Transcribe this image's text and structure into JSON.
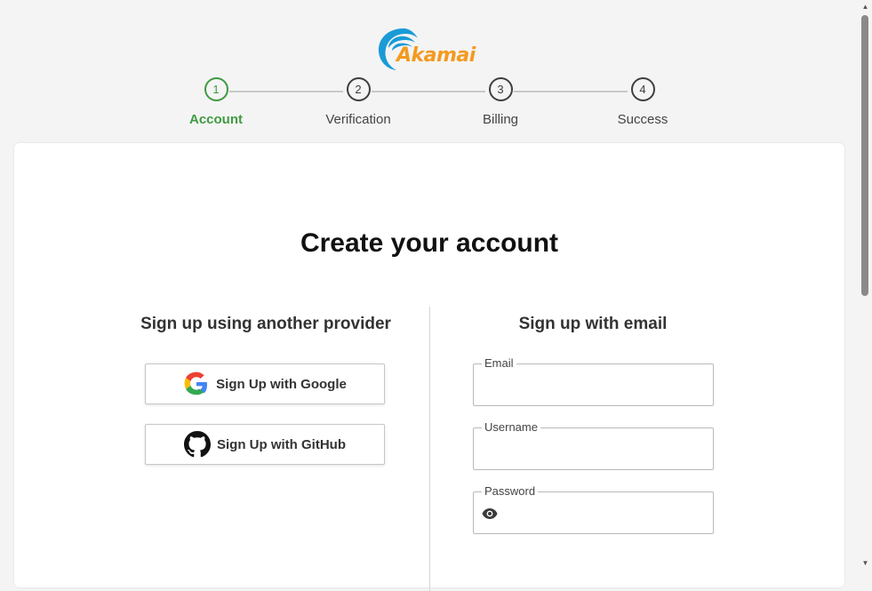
{
  "brand": {
    "logo_text": "Akamai",
    "color": "#f39a1f",
    "swoosh_color": "#1a9bd7"
  },
  "stepper": {
    "active_color": "#3f9b3f",
    "steps": [
      {
        "number": "1",
        "label": "Account",
        "state": "active"
      },
      {
        "number": "2",
        "label": "Verification",
        "state": "pending"
      },
      {
        "number": "3",
        "label": "Billing",
        "state": "pending"
      },
      {
        "number": "4",
        "label": "Success",
        "state": "pending"
      }
    ]
  },
  "main": {
    "title": "Create your account",
    "providers": {
      "heading": "Sign up using another provider",
      "google_label": "Sign Up with Google",
      "github_label": "Sign Up with GitHub"
    },
    "email_form": {
      "heading": "Sign up with email",
      "email": {
        "label": "Email",
        "value": ""
      },
      "username": {
        "label": "Username",
        "value": ""
      },
      "password": {
        "label": "Password",
        "value": "",
        "toggle_icon": "eye-icon"
      }
    }
  },
  "scrollbar": {
    "up_icon": "▲",
    "down_icon": "▼"
  }
}
